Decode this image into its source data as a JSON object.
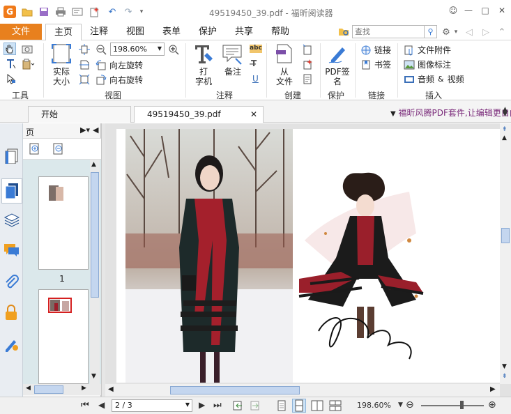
{
  "window": {
    "title": "49519450_39.pdf - 福昕阅读器",
    "app_icon_letter": "G",
    "controls": [
      "☺",
      "—",
      "□",
      "✕"
    ]
  },
  "quick_access": [
    "open-folder-icon",
    "save-icon",
    "print-icon",
    "email-icon",
    "new-icon",
    "undo-icon",
    "redo-icon",
    "customize-icon"
  ],
  "menu": {
    "file": "文件",
    "tabs": [
      "主页",
      "注释",
      "视图",
      "表单",
      "保护",
      "共享",
      "帮助"
    ],
    "active_tab": "主页",
    "search_placeholder": "查找"
  },
  "ribbon": {
    "groups": {
      "tools": "工具",
      "view": "视图",
      "comment": "注释",
      "create": "创建",
      "protect": "保护",
      "links": "链接",
      "insert": "插入"
    },
    "actual_size": [
      "实际",
      "大小"
    ],
    "zoom_value": "198.60%",
    "rotate_left": "向左旋转",
    "rotate_right": "向右旋转",
    "typewriter": [
      "打",
      "字机"
    ],
    "note": "备注",
    "from_file": [
      "从",
      "文件"
    ],
    "pdf_sign": [
      "PDF签",
      "名"
    ],
    "link": "链接",
    "bookmark": "书签",
    "file_attachment": "文件附件",
    "image_annotation": "图像标注",
    "audio_video": [
      "音频",
      "&",
      "视频"
    ]
  },
  "doc_tabs": {
    "start": "开始",
    "doc": "49519450_39.pdf",
    "promo": "福昕风腾PDF套件,让编辑更自由"
  },
  "panel": {
    "title": "页",
    "page_numbers": [
      "1"
    ]
  },
  "status": {
    "page_value": "2 / 3",
    "zoom": "198.60%"
  },
  "colors": {
    "accent": "#e8801e",
    "thumb_highlight": "#d42020",
    "scrollbar": "#c4d6ef"
  }
}
